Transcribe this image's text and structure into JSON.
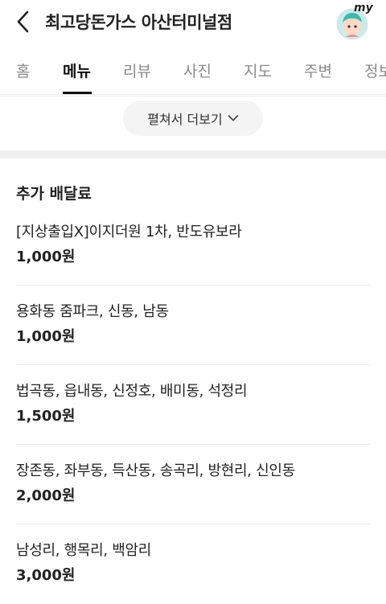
{
  "header": {
    "title": "최고당돈가스 아산터미널점",
    "avatar_label": "my"
  },
  "tabs": [
    {
      "label": "홈"
    },
    {
      "label": "메뉴",
      "active": true
    },
    {
      "label": "리뷰"
    },
    {
      "label": "사진"
    },
    {
      "label": "지도"
    },
    {
      "label": "주변"
    },
    {
      "label": "정보"
    }
  ],
  "expand_button": {
    "label": "펼쳐서 더보기"
  },
  "delivery_fees": {
    "title": "추가 배달료",
    "items": [
      {
        "area": "[지상출입X]이지더원 1차, 반도유보라",
        "price": "1,000원"
      },
      {
        "area": "용화동 줌파크, 신동, 남동",
        "price": "1,000원"
      },
      {
        "area": "법곡동, 읍내동, 신정호, 배미동, 석정리",
        "price": "1,500원"
      },
      {
        "area": "장존동, 좌부동, 득산동, 송곡리, 방현리, 신인동",
        "price": "2,000원"
      },
      {
        "area": "남성리, 행목리, 백암리",
        "price": "3,000원"
      }
    ]
  },
  "colors": {
    "text": "#222222",
    "inactive_tab": "#8a8a8a",
    "avatar_bg": "#c8ecec"
  }
}
